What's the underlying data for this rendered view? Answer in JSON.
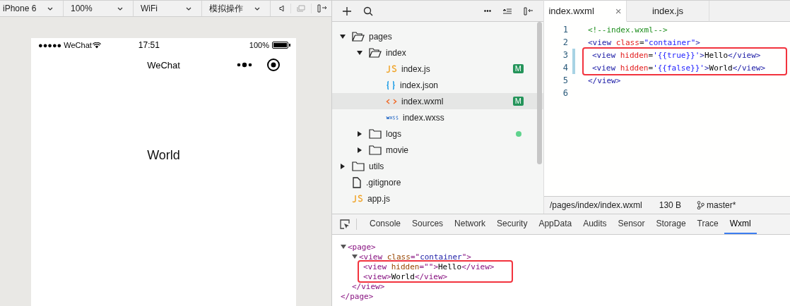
{
  "toolbar": {
    "dropdowns": [
      {
        "value": "iPhone 6"
      },
      {
        "value": "100%"
      },
      {
        "value": "WiFi"
      },
      {
        "value": "模拟操作"
      }
    ]
  },
  "phone": {
    "carrier": "●●●●● WeChat",
    "time": "17:51",
    "battery": "100%",
    "nav_title": "WeChat",
    "content": "World"
  },
  "file_tree": [
    {
      "name": "pages",
      "kind": "folder",
      "expanded": true,
      "selected": false,
      "children": [
        {
          "name": "index",
          "kind": "folder",
          "expanded": true,
          "selected": false,
          "children": [
            {
              "name": "index.js",
              "kind": "js",
              "selected": false,
              "badge": "M"
            },
            {
              "name": "index.json",
              "kind": "json",
              "selected": false
            },
            {
              "name": "index.wxml",
              "kind": "wxml",
              "selected": true,
              "badge": "M"
            },
            {
              "name": "index.wxss",
              "kind": "wxss",
              "selected": false
            }
          ]
        },
        {
          "name": "logs",
          "kind": "folder",
          "expanded": false,
          "selected": false,
          "color": "#5fd38d"
        },
        {
          "name": "movie",
          "kind": "folder",
          "expanded": false,
          "selected": false
        }
      ]
    },
    {
      "name": "utils",
      "kind": "folder",
      "expanded": false,
      "selected": false
    },
    {
      "name": ".gitignore",
      "kind": "file",
      "selected": false
    },
    {
      "name": "app.js",
      "kind": "js",
      "selected": false
    }
  ],
  "editor": {
    "tabs": [
      {
        "label": "index.wxml",
        "selected": true,
        "close": "×"
      },
      {
        "label": "index.js",
        "selected": false
      }
    ],
    "lines": [
      {
        "number": "1",
        "modified": false,
        "boxed": false,
        "tokens": [
          {
            "kind": "comment",
            "text": "<!--index.wxml-->"
          }
        ]
      },
      {
        "number": "2",
        "modified": false,
        "boxed": false,
        "tokens": [
          {
            "kind": "tag",
            "text": "<view "
          },
          {
            "kind": "attr",
            "text": "class"
          },
          {
            "kind": "punct",
            "text": "="
          },
          {
            "kind": "value",
            "text": "\"container\""
          },
          {
            "kind": "tag",
            "text": ">"
          }
        ]
      },
      {
        "number": "3",
        "modified": true,
        "boxed": true,
        "tokens": [
          {
            "kind": "tag",
            "text": "<view "
          },
          {
            "kind": "attr",
            "text": "hidden"
          },
          {
            "kind": "punct",
            "text": "="
          },
          {
            "kind": "value",
            "text": "'{{true}}'"
          },
          {
            "kind": "tag",
            "text": ">"
          },
          {
            "kind": "text",
            "text": "Hello"
          },
          {
            "kind": "tag",
            "text": "</view>"
          }
        ]
      },
      {
        "number": "4",
        "modified": true,
        "boxed": true,
        "tokens": [
          {
            "kind": "tag",
            "text": "<view "
          },
          {
            "kind": "attr",
            "text": "hidden"
          },
          {
            "kind": "punct",
            "text": "="
          },
          {
            "kind": "value",
            "text": "'{{false}}'"
          },
          {
            "kind": "tag",
            "text": ">"
          },
          {
            "kind": "text",
            "text": "World"
          },
          {
            "kind": "tag",
            "text": "</view>"
          }
        ]
      },
      {
        "number": "5",
        "modified": false,
        "boxed": false,
        "tokens": [
          {
            "kind": "tag",
            "text": "</view>"
          }
        ]
      },
      {
        "number": "6",
        "modified": false,
        "boxed": false
      }
    ],
    "status": {
      "path": "/pages/index/index.wxml",
      "size": "130 B",
      "branch": "master*"
    }
  },
  "devtools": {
    "tabs": [
      {
        "label": "Console",
        "selected": false
      },
      {
        "label": "Sources",
        "selected": false
      },
      {
        "label": "Network",
        "selected": false
      },
      {
        "label": "Security",
        "selected": false
      },
      {
        "label": "AppData",
        "selected": false
      },
      {
        "label": "Audits",
        "selected": false
      },
      {
        "label": "Sensor",
        "selected": false
      },
      {
        "label": "Storage",
        "selected": false
      },
      {
        "label": "Trace",
        "selected": false
      },
      {
        "label": "Wxml",
        "selected": true
      }
    ],
    "tree": [
      {
        "expanded": true,
        "boxed": false,
        "tokens": [
          {
            "kind": "tag",
            "text": "<page>"
          }
        ],
        "close": [
          {
            "kind": "tag",
            "text": "</page>"
          }
        ],
        "children": [
          {
            "expanded": true,
            "boxed": false,
            "tokens": [
              {
                "kind": "tag",
                "text": "<view "
              },
              {
                "kind": "attr",
                "text": "class"
              },
              {
                "kind": "punct",
                "text": "=\""
              },
              {
                "kind": "value",
                "text": "container"
              },
              {
                "kind": "punct",
                "text": "\""
              },
              {
                "kind": "tag",
                "text": ">"
              }
            ],
            "close": [
              {
                "kind": "tag",
                "text": "</view>"
              }
            ],
            "children": [
              {
                "boxed": true,
                "tokens": [
                  {
                    "kind": "tag",
                    "text": "<view "
                  },
                  {
                    "kind": "attr",
                    "text": "hidden"
                  },
                  {
                    "kind": "punct",
                    "text": "=\"\""
                  },
                  {
                    "kind": "tag",
                    "text": ">"
                  },
                  {
                    "kind": "text",
                    "text": "Hello"
                  },
                  {
                    "kind": "tag",
                    "text": "</view>"
                  }
                ]
              },
              {
                "boxed": true,
                "tokens": [
                  {
                    "kind": "tag",
                    "text": "<view>"
                  },
                  {
                    "kind": "text",
                    "text": "World"
                  },
                  {
                    "kind": "tag",
                    "text": "</view>"
                  }
                ]
              }
            ]
          }
        ]
      }
    ]
  }
}
